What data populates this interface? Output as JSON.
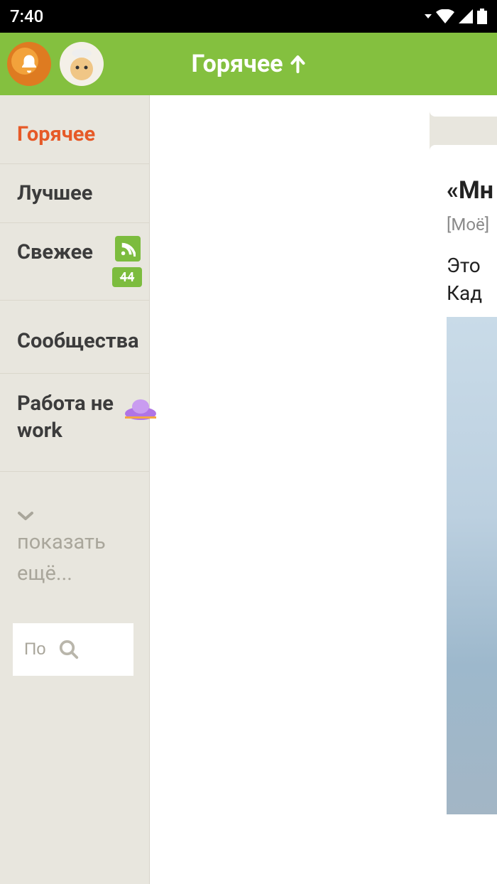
{
  "statusbar": {
    "time": "7:40"
  },
  "header": {
    "title": "Горячее"
  },
  "sidebar": {
    "items": [
      {
        "label": "Горячее"
      },
      {
        "label": "Лучшее"
      },
      {
        "label": "Свежее",
        "count": "44"
      },
      {
        "label": "Сообщества"
      },
      {
        "label": "Работа не work"
      }
    ],
    "show_more": "показать ещё..."
  },
  "search": {
    "placeholder": "По"
  },
  "post": {
    "title_fragment": "«Мн",
    "tag": "[Моё]",
    "body_line1": "Это ",
    "body_line2": "Кад"
  }
}
